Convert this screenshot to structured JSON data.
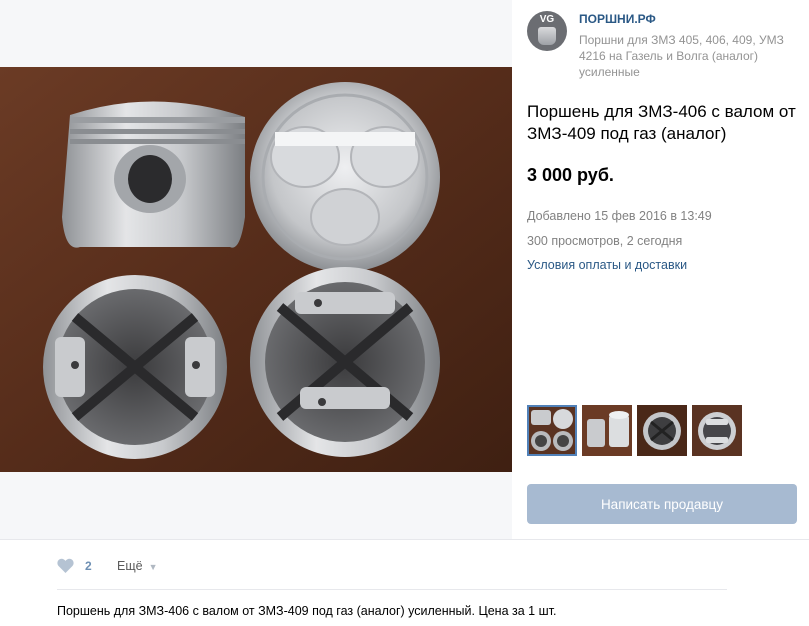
{
  "seller": {
    "avatar_text": "VG",
    "name": "ПОРШНИ.РФ",
    "description": "Поршни для ЗМЗ 405, 406, 409, УМЗ 4216 на Газель и Волга (аналог) усиленные"
  },
  "product": {
    "title": "Поршень для ЗМЗ-406 с валом от ЗМЗ-409 под газ (аналог)",
    "price": "3 000 руб.",
    "added": "Добавлено 15 фев 2016 в 13:49",
    "views": "300 просмотров, 2 сегодня",
    "delivery_link": "Условия оплаты и доставки",
    "thumbnails": [
      "photo-1",
      "photo-2",
      "photo-3",
      "photo-4"
    ],
    "selected_thumbnail": 0
  },
  "contact_button": "Написать продавцу",
  "actions": {
    "like_count": "2",
    "more_label": "Ещё"
  },
  "description": "Поршень для ЗМЗ-406 с валом от ЗМЗ-409 под газ (аналог) усиленный. Цена за 1 шт.",
  "colors": {
    "link": "#2a5885",
    "button": "#a7bad1",
    "like": "#6d8fb3",
    "photo_background": "#5a3322"
  }
}
